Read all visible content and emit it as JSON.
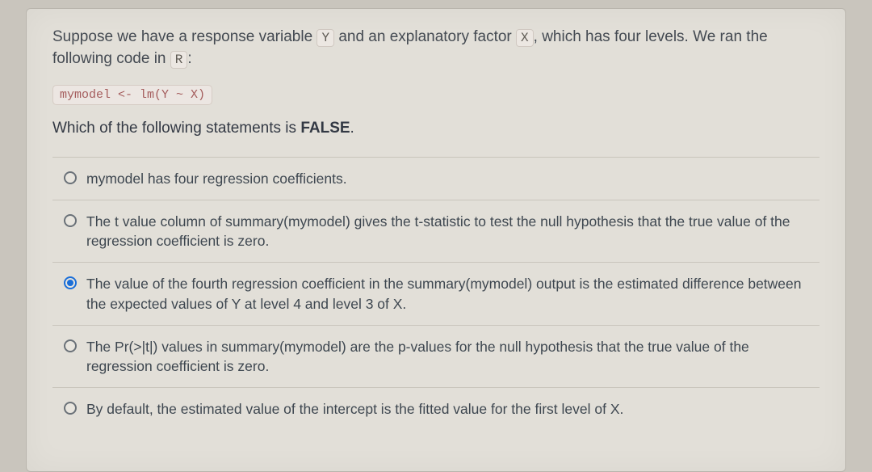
{
  "question": {
    "pre1": "Suppose we have a response variable ",
    "var1": "Y",
    "mid1": " and an explanatory factor ",
    "var2": "X",
    "post1": ", which has four levels. We ran the following code in ",
    "var3": "R",
    "post2": ":"
  },
  "code": "mymodel <- lm(Y ~ X)",
  "prompt": {
    "pre": "Which of the following statements is ",
    "bold": "FALSE",
    "post": "."
  },
  "options": [
    {
      "text": "mymodel has four regression coefficients.",
      "selected": false
    },
    {
      "text": "The t value column of summary(mymodel) gives the t-statistic to test the null hypothesis that the true value of the regression coefficient is zero.",
      "selected": false
    },
    {
      "text": "The value of the fourth regression coefficient in the summary(mymodel) output is the estimated difference between the expected values of Y at level 4 and level 3 of X.",
      "selected": true
    },
    {
      "text": "The Pr(>|t|) values in summary(mymodel) are the p-values for the null hypothesis that the true value of the regression coefficient is zero.",
      "selected": false
    },
    {
      "text": "By default, the estimated value of the intercept is the fitted value for the first level of X.",
      "selected": false
    }
  ]
}
